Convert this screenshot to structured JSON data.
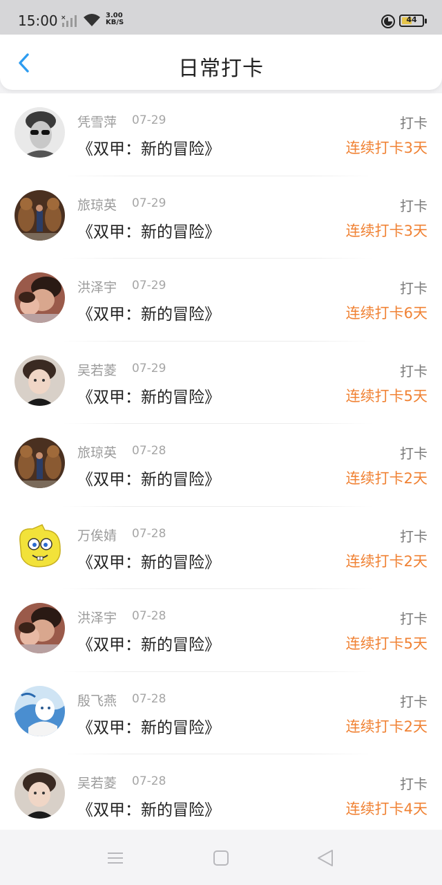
{
  "status_bar": {
    "time": "15:00",
    "speed_value": "3.00",
    "speed_unit": "KB/S",
    "battery": "44",
    "battery_level": 0.44,
    "icons": [
      "signal-icon",
      "wifi-icon",
      "data-saver-icon",
      "battery-icon"
    ]
  },
  "header": {
    "back_icon": "chevron-left-icon",
    "title": "日常打卡"
  },
  "colors": {
    "accent_blue": "#2d9cf0",
    "streak_orange": "#f08234"
  },
  "list": {
    "items": [
      {
        "name": "凭雪萍",
        "date": "07-29",
        "book": "《双甲：新的冒险》",
        "action": "打卡",
        "streak": "连续打卡3天",
        "avatar": "avatar-man-sunglasses"
      },
      {
        "name": "旅琼英",
        "date": "07-29",
        "book": "《双甲：新的冒险》",
        "action": "打卡",
        "streak": "连续打卡3天",
        "avatar": "avatar-chipmunks"
      },
      {
        "name": "洪泽宇",
        "date": "07-29",
        "book": "《双甲：新的冒险》",
        "action": "打卡",
        "streak": "连续打卡6天",
        "avatar": "avatar-couple"
      },
      {
        "name": "吴若菱",
        "date": "07-29",
        "book": "《双甲：新的冒险》",
        "action": "打卡",
        "streak": "连续打卡5天",
        "avatar": "avatar-young-man"
      },
      {
        "name": "旅琼英",
        "date": "07-28",
        "book": "《双甲：新的冒险》",
        "action": "打卡",
        "streak": "连续打卡2天",
        "avatar": "avatar-chipmunks"
      },
      {
        "name": "万俟婧",
        "date": "07-28",
        "book": "《双甲：新的冒险》",
        "action": "打卡",
        "streak": "连续打卡2天",
        "avatar": "avatar-sponge-cartoon"
      },
      {
        "name": "洪泽宇",
        "date": "07-28",
        "book": "《双甲：新的冒险》",
        "action": "打卡",
        "streak": "连续打卡5天",
        "avatar": "avatar-couple"
      },
      {
        "name": "殷飞燕",
        "date": "07-28",
        "book": "《双甲：新的冒险》",
        "action": "打卡",
        "streak": "连续打卡2天",
        "avatar": "avatar-anime"
      },
      {
        "name": "吴若菱",
        "date": "07-28",
        "book": "《双甲：新的冒险》",
        "action": "打卡",
        "streak": "连续打卡4天",
        "avatar": "avatar-young-man"
      }
    ]
  },
  "nav_bar": {
    "buttons": [
      "menu-icon",
      "home-square-icon",
      "back-triangle-icon"
    ]
  }
}
